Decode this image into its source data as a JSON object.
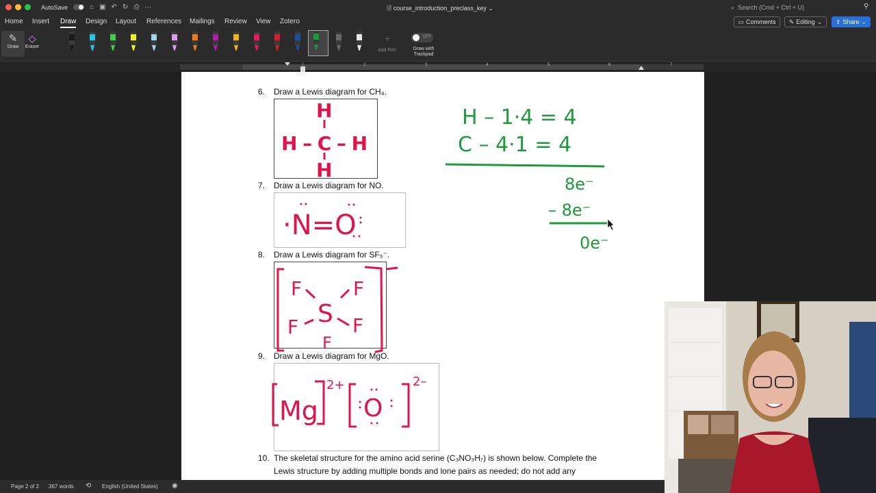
{
  "window": {
    "title": "course_introduction_preclass_key",
    "autosave_label": "AutoSave",
    "search_placeholder": "Search (Cmd + Ctrl + U)"
  },
  "ribbon": {
    "tabs": [
      "Home",
      "Insert",
      "Draw",
      "Design",
      "Layout",
      "References",
      "Mailings",
      "Review",
      "View",
      "Zotero"
    ],
    "active_tab": "Draw",
    "comments_label": "Comments",
    "editing_label": "Editing",
    "share_label": "Share"
  },
  "toolbar": {
    "draw_label": "Draw",
    "eraser_label": "Eraser",
    "add_pen_label": "Add Pen",
    "trackpad_label": "Draw with Trackpad",
    "trackpad_state": "OFF",
    "pen_colors": [
      "#1a1a1a",
      "#1ec8e6",
      "#3fd13f",
      "#f5f21a",
      "#9fd6ee",
      "#d99cf0",
      "#f07a1a",
      "#b01cb0",
      "#f2b21a",
      "#e61a5a",
      "#d81a2a",
      "#1a4fa8",
      "#1a9a3a",
      "#6a6a6a",
      "#e8e8e8"
    ],
    "selected_pen_index": 12
  },
  "ruler": {
    "numbers": [
      "1",
      "2",
      "3",
      "4",
      "5",
      "6",
      "7"
    ]
  },
  "document": {
    "questions": [
      {
        "num": "6.",
        "text": "Draw a Lewis diagram for CH₄."
      },
      {
        "num": "7.",
        "text": "Draw a Lewis diagram for NO."
      },
      {
        "num": "8.",
        "text": "Draw a Lewis diagram for SF₅⁻."
      },
      {
        "num": "9.",
        "text": "Draw a Lewis diagram for MgO."
      },
      {
        "num": "10.",
        "text": "The skeletal structure for the amino acid serine (C₃NO₃H₇) is shown below. Complete the",
        "text2": "Lewis structure by adding multiple bonds and lone pairs as needed; do not add any"
      }
    ],
    "ink": {
      "ch4": {
        "h_top": "H",
        "row": "H–C–H",
        "h_bottom": "H"
      },
      "no": {
        "molecule": "·N=O"
      },
      "sf5": {
        "s": "S",
        "f": "F",
        "charge": "–"
      },
      "mgo": {
        "mg": "Mg",
        "mg_charge": "2+",
        "o": "O",
        "o_charge": "2–"
      },
      "work": {
        "line1": "H – 1·4 = 4",
        "line2": "C – 4·1 = 4",
        "line3": "8e⁻",
        "line4": "– 8e⁻",
        "line5": "0e⁻"
      },
      "colors": {
        "red": "#e0134a",
        "green": "#1e9a3a"
      }
    }
  },
  "status": {
    "page": "Page 2 of 2",
    "words": "367 words",
    "language": "English (United States)"
  }
}
